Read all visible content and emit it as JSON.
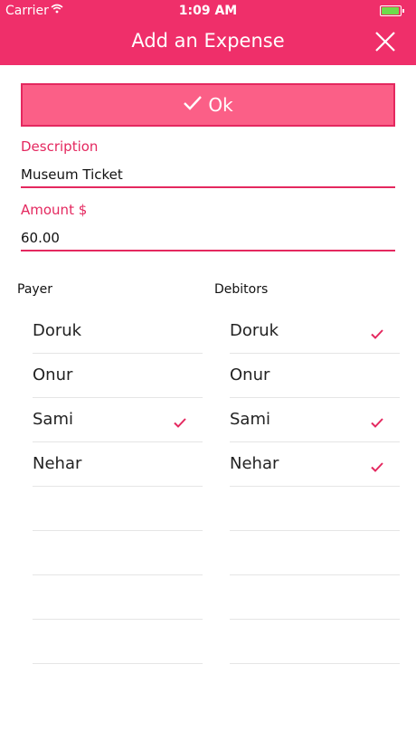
{
  "status_bar": {
    "carrier": "Carrier",
    "wifi_icon": "wifi-icon",
    "time": "1:09 AM",
    "battery_icon": "battery-icon",
    "battery_color": "#6edb4b"
  },
  "header": {
    "title": "Add an Expense",
    "close_icon": "close-icon",
    "color": "#ef2f6a"
  },
  "ok_button": {
    "label": "Ok",
    "icon": "checkmark-icon",
    "color": "#fb5f87"
  },
  "form": {
    "description": {
      "label": "Description",
      "value": "Museum Ticket"
    },
    "amount": {
      "label": "Amount $",
      "value": "60.00"
    }
  },
  "payer": {
    "heading": "Payer",
    "items": [
      {
        "name": "Doruk",
        "checked": false
      },
      {
        "name": "Onur",
        "checked": false
      },
      {
        "name": "Sami",
        "checked": true
      },
      {
        "name": "Nehar",
        "checked": false
      },
      {
        "name": "",
        "checked": false
      },
      {
        "name": "",
        "checked": false
      },
      {
        "name": "",
        "checked": false
      },
      {
        "name": "",
        "checked": false
      }
    ]
  },
  "debitors": {
    "heading": "Debitors",
    "items": [
      {
        "name": "Doruk",
        "checked": true
      },
      {
        "name": "Onur",
        "checked": false
      },
      {
        "name": "Sami",
        "checked": true
      },
      {
        "name": "Nehar",
        "checked": true
      },
      {
        "name": "",
        "checked": false
      },
      {
        "name": "",
        "checked": false
      },
      {
        "name": "",
        "checked": false
      },
      {
        "name": "",
        "checked": false
      }
    ]
  },
  "accent_color": "#e4285f"
}
